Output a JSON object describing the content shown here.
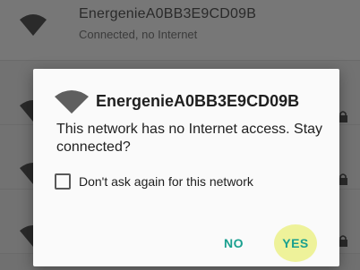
{
  "network_list": {
    "top_item": {
      "name": "EnergenieA0BB3E9CD09B",
      "status": "Connected, no Internet"
    }
  },
  "dialog": {
    "title": "EnergenieA0BB3E9CD09B",
    "message": "This network has no Internet access. Stay connected?",
    "checkbox_label": "Don't ask again for this network",
    "checkbox_checked": false,
    "no_label": "NO",
    "yes_label": "YES"
  },
  "colors": {
    "accent": "#1aa08f",
    "highlight": "#eef29a",
    "scrim": "#707070"
  },
  "icons": {
    "list_wifi": "wifi-icon",
    "lock": "lock-icon",
    "dialog_wifi": "wifi-icon"
  }
}
